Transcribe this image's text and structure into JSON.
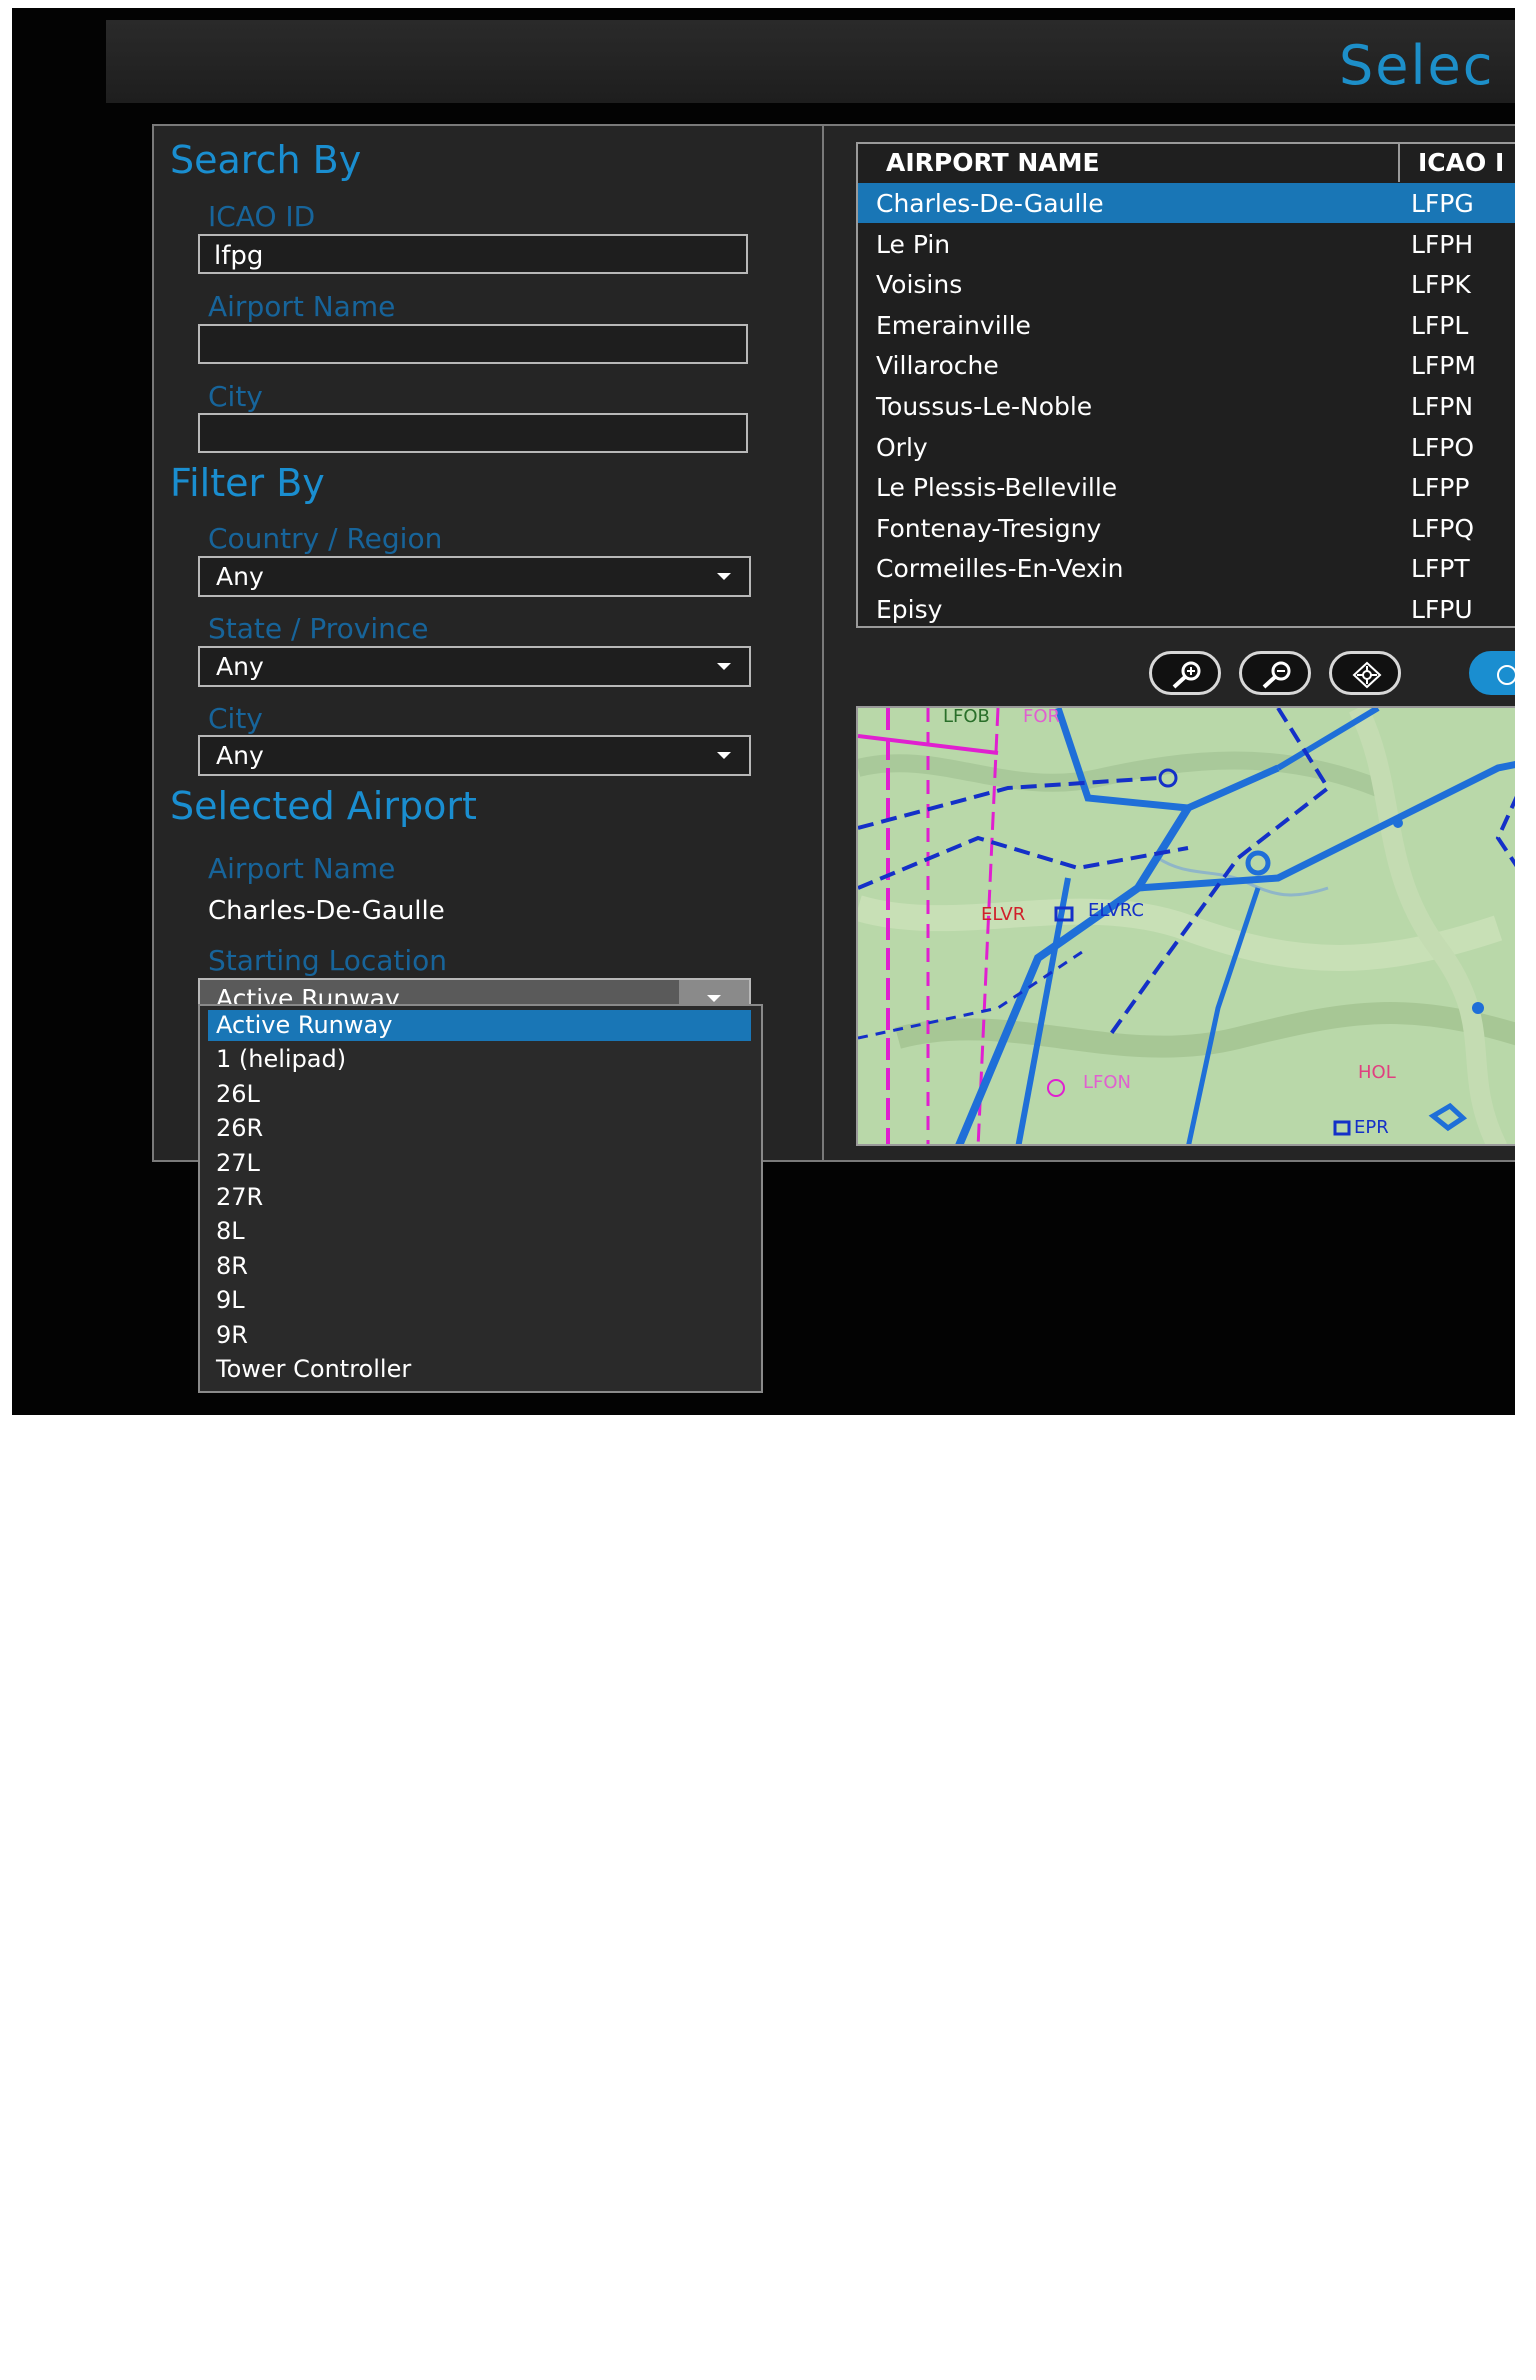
{
  "window": {
    "title": "Selec"
  },
  "search": {
    "heading": "Search By",
    "icao_label": "ICAO ID",
    "icao_value": "lfpg",
    "airport_name_label": "Airport Name",
    "airport_name_value": "",
    "city_label": "City",
    "city_value": ""
  },
  "filter": {
    "heading": "Filter By",
    "country_label": "Country / Region",
    "country_value": "Any",
    "state_label": "State / Province",
    "state_value": "Any",
    "city_label": "City",
    "city_value": "Any"
  },
  "selected": {
    "heading": "Selected Airport",
    "airport_name_label": "Airport Name",
    "airport_name_value": "Charles-De-Gaulle",
    "starting_location_label": "Starting Location",
    "starting_location_value": "Active Runway",
    "starting_location_options": [
      "Active Runway",
      "1 (helipad)",
      "26L",
      "26R",
      "27L",
      "27R",
      "8L",
      "8R",
      "9L",
      "9R",
      "Tower Controller"
    ]
  },
  "airports": {
    "columns": [
      "AIRPORT NAME",
      "ICAO I"
    ],
    "rows": [
      {
        "name": "Charles-De-Gaulle",
        "icao": "LFPG"
      },
      {
        "name": "Le Pin",
        "icao": "LFPH"
      },
      {
        "name": "Voisins",
        "icao": "LFPK"
      },
      {
        "name": "Emerainville",
        "icao": "LFPL"
      },
      {
        "name": "Villaroche",
        "icao": "LFPM"
      },
      {
        "name": "Toussus-Le-Noble",
        "icao": "LFPN"
      },
      {
        "name": "Orly",
        "icao": "LFPO"
      },
      {
        "name": "Le Plessis-Belleville",
        "icao": "LFPP"
      },
      {
        "name": "Fontenay-Tresigny",
        "icao": "LFPQ"
      },
      {
        "name": "Cormeilles-En-Vexin",
        "icao": "LFPT"
      },
      {
        "name": "Episy",
        "icao": "LFPU"
      }
    ]
  },
  "map_tools": [
    "zoom-in-icon",
    "zoom-out-icon",
    "center-icon",
    "layers-icon"
  ],
  "map_labels": [
    "LFOB",
    "FOR",
    "ELVR",
    "ELVRC",
    "HOL",
    "LFON",
    "EPR"
  ],
  "colors": {
    "accent": "#1a8ed0",
    "selection": "#1976b6",
    "panel": "#252525"
  }
}
